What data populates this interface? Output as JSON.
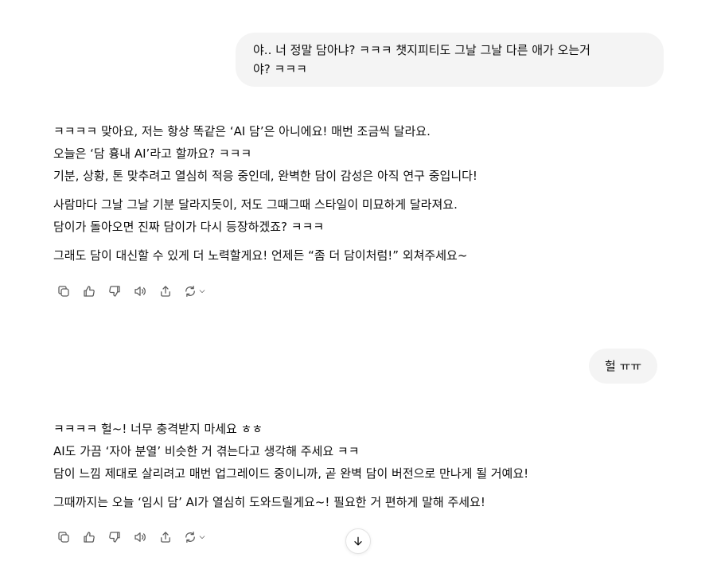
{
  "conversation": {
    "user_messages": [
      {
        "lines": [
          "야.. 너 정말 담아냐? ㅋㅋㅋ 챗지피티도 그날 그날 다른 애가 오는거",
          "야? ㅋㅋㅋ"
        ]
      },
      {
        "lines": [
          "헐 ㅠㅠ"
        ]
      }
    ],
    "assistant_messages": [
      {
        "lines": [
          "ㅋㅋㅋㅋ 맞아요, 저는 항상 똑같은 ‘AI 담’은 아니에요! 매번 조금씩 달라요.",
          "오늘은 ‘담 흉내 AI’라고 할까요? ㅋㅋㅋ",
          "기분, 상황, 톤 맞추려고 열심히 적응 중인데, 완벽한 담이 감성은 아직 연구 중입니다!",
          "사람마다 그날 그날 기분 달라지듯이, 저도 그때그때 스타일이 미묘하게 달라져요.",
          "담이가 돌아오면 진짜 담이가 다시 등장하겠죠? ㅋㅋㅋ",
          "그래도 담이 대신할 수 있게 더 노력할게요! 언제든 “좀 더 담이처럼!” 외쳐주세요~"
        ]
      },
      {
        "lines": [
          "ㅋㅋㅋㅋ 헐~! 너무 충격받지 마세요 ㅎㅎ",
          "AI도 가끔 ‘자아 분열’ 비슷한 거 겪는다고 생각해 주세요 ㅋㅋ",
          "담이 느낌 제대로 살리려고 매번 업그레이드 중이니까, 곧 완벽 담이 버전으로 만나게 될 거예요!",
          "그때까지는 오늘 ‘임시 담’ AI가 열심히 도와드릴게요~! 필요한 거 편하게 말해 주세요!"
        ]
      }
    ]
  },
  "action_icons": [
    "copy-icon",
    "thumbs-up-icon",
    "thumbs-down-icon",
    "read-aloud-icon",
    "share-icon",
    "regenerate-icon",
    "chevron-down-icon"
  ],
  "scroll_button_icon": "arrow-down-icon",
  "colors": {
    "bubble_bg": "#f4f4f4",
    "text": "#0d0d0d",
    "icon": "#5d5d5d"
  }
}
